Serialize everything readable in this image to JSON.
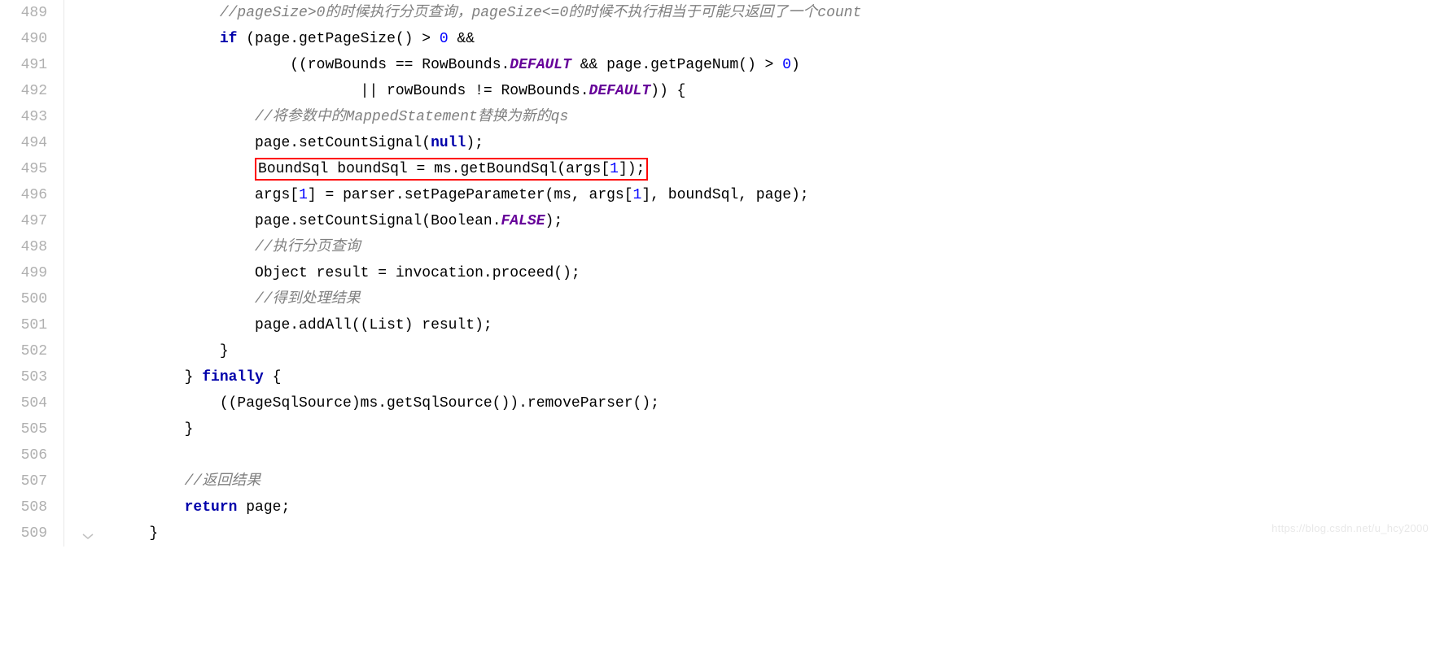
{
  "gutter": {
    "start": 489,
    "end": 509
  },
  "code": {
    "lines": [
      {
        "indent": "                ",
        "segments": [
          {
            "cls": "comment",
            "text": "//pageSize>0的时候执行分页查询，pageSize<=0的时候不执行相当于可能只返回了一个count"
          }
        ]
      },
      {
        "indent": "                ",
        "segments": [
          {
            "cls": "keyword",
            "text": "if"
          },
          {
            "cls": "",
            "text": " (page.getPageSize() > "
          },
          {
            "cls": "number",
            "text": "0"
          },
          {
            "cls": "",
            "text": " &&"
          }
        ]
      },
      {
        "indent": "                        ",
        "segments": [
          {
            "cls": "",
            "text": "((rowBounds == RowBounds."
          },
          {
            "cls": "constant",
            "text": "DEFAULT"
          },
          {
            "cls": "",
            "text": " && page.getPageNum() > "
          },
          {
            "cls": "number",
            "text": "0"
          },
          {
            "cls": "",
            "text": ")"
          }
        ]
      },
      {
        "indent": "                                ",
        "segments": [
          {
            "cls": "",
            "text": "|| rowBounds != RowBounds."
          },
          {
            "cls": "constant",
            "text": "DEFAULT"
          },
          {
            "cls": "",
            "text": ")) {"
          }
        ]
      },
      {
        "indent": "                    ",
        "segments": [
          {
            "cls": "comment",
            "text": "//将参数中的MappedStatement替换为新的qs"
          }
        ]
      },
      {
        "indent": "                    ",
        "segments": [
          {
            "cls": "",
            "text": "page.setCountSignal("
          },
          {
            "cls": "keyword",
            "text": "null"
          },
          {
            "cls": "",
            "text": ");"
          }
        ]
      },
      {
        "indent": "                    ",
        "highlight": true,
        "segments": [
          {
            "cls": "",
            "text": "BoundSql boundSql = ms.getBoundSql(args["
          },
          {
            "cls": "number",
            "text": "1"
          },
          {
            "cls": "",
            "text": "]);"
          }
        ]
      },
      {
        "indent": "                    ",
        "segments": [
          {
            "cls": "",
            "text": "args["
          },
          {
            "cls": "number",
            "text": "1"
          },
          {
            "cls": "",
            "text": "] = parser.setPageParameter(ms, args["
          },
          {
            "cls": "number",
            "text": "1"
          },
          {
            "cls": "",
            "text": "], boundSql, page);"
          }
        ]
      },
      {
        "indent": "                    ",
        "segments": [
          {
            "cls": "",
            "text": "page.setCountSignal(Boolean."
          },
          {
            "cls": "constant",
            "text": "FALSE"
          },
          {
            "cls": "",
            "text": ");"
          }
        ]
      },
      {
        "indent": "                    ",
        "segments": [
          {
            "cls": "comment",
            "text": "//执行分页查询"
          }
        ]
      },
      {
        "indent": "                    ",
        "segments": [
          {
            "cls": "",
            "text": "Object result = invocation.proceed();"
          }
        ]
      },
      {
        "indent": "                    ",
        "segments": [
          {
            "cls": "comment",
            "text": "//得到处理结果"
          }
        ]
      },
      {
        "indent": "                    ",
        "segments": [
          {
            "cls": "",
            "text": "page.addAll((List) result);"
          }
        ]
      },
      {
        "indent": "                ",
        "segments": [
          {
            "cls": "",
            "text": "}"
          }
        ]
      },
      {
        "indent": "            ",
        "segments": [
          {
            "cls": "",
            "text": "} "
          },
          {
            "cls": "keyword",
            "text": "finally"
          },
          {
            "cls": "",
            "text": " {"
          }
        ]
      },
      {
        "indent": "                ",
        "segments": [
          {
            "cls": "",
            "text": "((PageSqlSource)ms.getSqlSource()).removeParser();"
          }
        ]
      },
      {
        "indent": "            ",
        "segments": [
          {
            "cls": "",
            "text": "}"
          }
        ]
      },
      {
        "indent": "",
        "segments": [
          {
            "cls": "",
            "text": ""
          }
        ]
      },
      {
        "indent": "            ",
        "segments": [
          {
            "cls": "comment",
            "text": "//返回结果"
          }
        ]
      },
      {
        "indent": "            ",
        "segments": [
          {
            "cls": "keyword",
            "text": "return"
          },
          {
            "cls": "",
            "text": " page;"
          }
        ]
      },
      {
        "indent": "        ",
        "segments": [
          {
            "cls": "",
            "text": "}"
          }
        ]
      }
    ]
  },
  "watermark": "https://blog.csdn.net/u_hcy2000"
}
